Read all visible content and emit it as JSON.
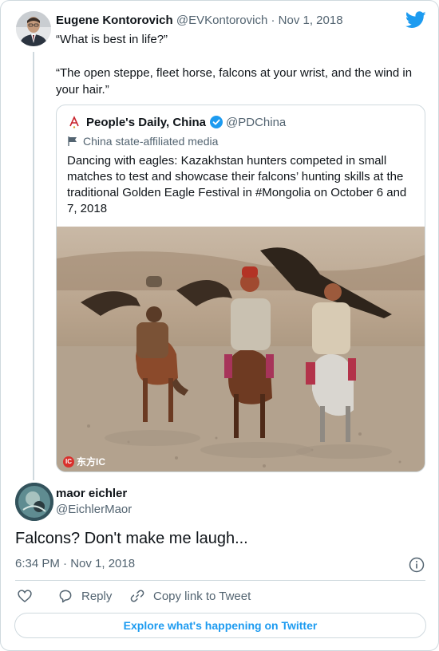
{
  "reply_tweet": {
    "author_name": "Eugene Kontorovich",
    "author_handle": "@EVKontorovich",
    "separator": "·",
    "date": "Nov 1, 2018",
    "text_line1": "“What is best in life?”",
    "text_line2": "“The open steppe, fleet horse, falcons at your wrist, and the wind in your hair.”",
    "avatar_icon": "person-avatar",
    "brand_icon": "twitter-bird-icon"
  },
  "quoted_tweet": {
    "author_name": "People's Daily, China",
    "author_handle": "@PDChina",
    "affiliation": "China state-affiliated media",
    "text": "Dancing with eagles: Kazakhstan hunters competed in small matches to test and showcase their falcons’ hunting skills at the traditional Golden Eagle Festival in #Mongolia on October 6 and 7, 2018",
    "photo_subject": "three horsemen with eagles",
    "watermark": "东方IC",
    "watermark_badge": "IC"
  },
  "main_tweet": {
    "author_name": "maor eichler",
    "author_handle": "@EichlerMaor",
    "text": "Falcons?  Don't make me laugh...",
    "timestamp": "6:34 PM · Nov 1, 2018"
  },
  "actions": {
    "reply_label": "Reply",
    "copy_label": "Copy link to Tweet"
  },
  "explore_label": "Explore what's happening on Twitter",
  "colors": {
    "accent": "#1d9bf0",
    "text": "#0f1419",
    "muted": "#536471",
    "border": "#cfd9de"
  }
}
